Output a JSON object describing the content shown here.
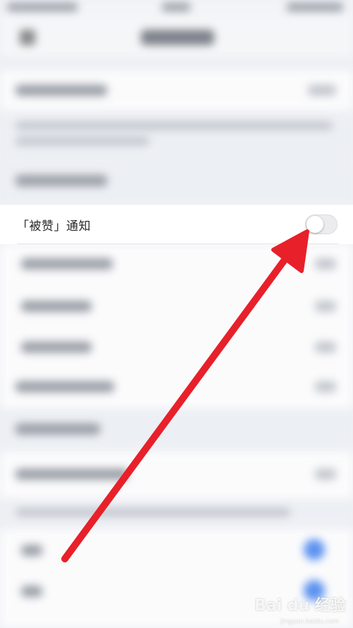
{
  "notification_row": {
    "label": "「被赞」通知",
    "toggle_state": "off"
  },
  "watermark": {
    "brand": "Bai du 经验",
    "url": "jingyan.baidu.com"
  },
  "colors": {
    "arrow": "#e8202a",
    "background": "#eef0f4",
    "row_background": "#ffffff",
    "toggle_off": "#ececee"
  },
  "icons": {
    "toggle": "toggle-switch",
    "pointer": "red-arrow"
  }
}
